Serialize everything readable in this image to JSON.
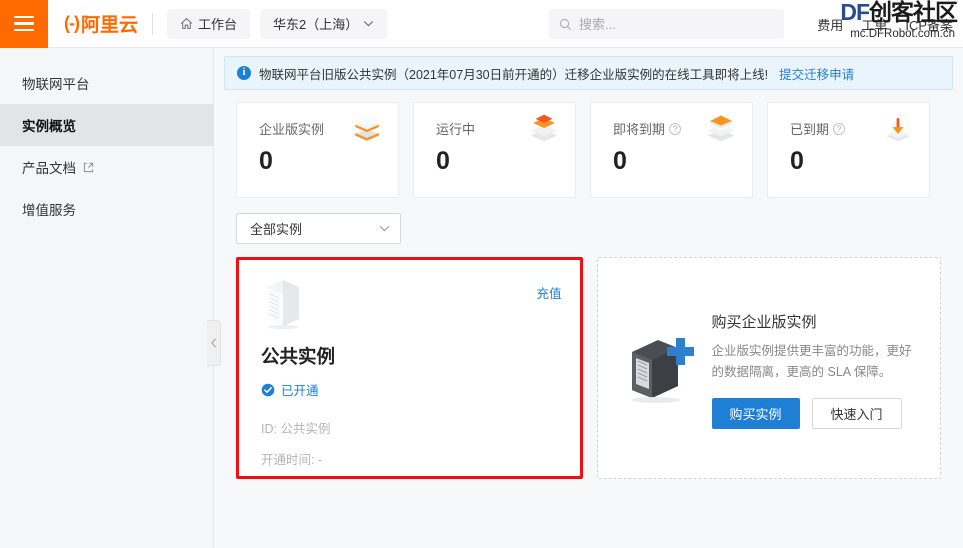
{
  "header": {
    "menu_icon": "hamburger-icon",
    "logo_mark": "(-)",
    "logo_text": "阿里云",
    "workbench": "工作台",
    "region": "华东2（上海）",
    "search_placeholder": "搜索...",
    "links": [
      "费用",
      "工单",
      "ICP备案"
    ]
  },
  "watermark": {
    "brand_df": "DF",
    "brand_cn": "创客社区",
    "url": "mc.DFRobot.com.cn"
  },
  "sidebar": {
    "items": [
      {
        "label": "物联网平台",
        "active": false,
        "external": false
      },
      {
        "label": "实例概览",
        "active": true,
        "external": false
      },
      {
        "label": "产品文档",
        "active": false,
        "external": true
      },
      {
        "label": "增值服务",
        "active": false,
        "external": false
      }
    ]
  },
  "banner": {
    "text": "物联网平台旧版公共实例（2021年07月30日前开通的）迁移企业版实例的在线工具即将上线!",
    "link": "提交迁移申请"
  },
  "stats": [
    {
      "label": "企业版实例",
      "value": "0",
      "help": false,
      "icon": "stack-layers-icon"
    },
    {
      "label": "运行中",
      "value": "0",
      "help": false,
      "icon": "stack-running-icon"
    },
    {
      "label": "即将到期",
      "value": "0",
      "help": true,
      "icon": "stack-expiring-icon"
    },
    {
      "label": "已到期",
      "value": "0",
      "help": true,
      "icon": "download-expired-icon"
    }
  ],
  "help_glyph": "?",
  "filter": {
    "selected": "全部实例"
  },
  "instance": {
    "topup": "充值",
    "title": "公共实例",
    "status": "已开通",
    "id_label": "ID: 公共实例",
    "open_time_label": "开通时间: -"
  },
  "promo": {
    "title": "购买企业版实例",
    "desc": "企业版实例提供更丰富的功能，更好的数据隔离，更高的 SLA 保障。",
    "buy_button": "购买实例",
    "quickstart_button": "快速入门"
  },
  "colors": {
    "brand_orange": "#ff6a00",
    "link_blue": "#1f7fd4",
    "highlight_red": "#ee1111"
  }
}
